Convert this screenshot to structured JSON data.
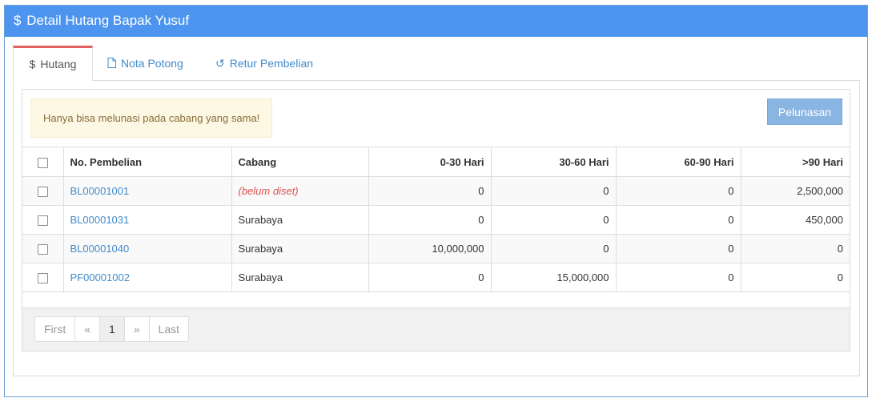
{
  "panel": {
    "icon": "dollar-icon",
    "title_symbol": "$",
    "title": "Detail Hutang Bapak Yusuf"
  },
  "tabs": [
    {
      "icon": "dollar-icon",
      "glyph": "$",
      "label": "Hutang",
      "active": true
    },
    {
      "icon": "document-icon",
      "label": "Nota Potong",
      "active": false
    },
    {
      "icon": "undo-icon",
      "glyph": "↺",
      "label": "Retur Pembelian",
      "active": false
    }
  ],
  "alert": {
    "text": "Hanya bisa melunasi pada cabang yang sama!"
  },
  "actions": {
    "pelunasan_label": "Pelunasan"
  },
  "table": {
    "headers": {
      "no_pembelian": "No. Pembelian",
      "cabang": "Cabang",
      "d0_30": "0-30 Hari",
      "d30_60": "30-60 Hari",
      "d60_90": "60-90 Hari",
      "d90plus": ">90 Hari"
    },
    "rows": [
      {
        "no": "BL00001001",
        "cabang": "(belum diset)",
        "d0_30": "0",
        "d30_60": "0",
        "d60_90": "0",
        "d90plus": "2,500,000"
      },
      {
        "no": "BL00001031",
        "cabang": "Surabaya",
        "d0_30": "0",
        "d30_60": "0",
        "d60_90": "0",
        "d90plus": "450,000"
      },
      {
        "no": "BL00001040",
        "cabang": "Surabaya",
        "d0_30": "10,000,000",
        "d30_60": "0",
        "d60_90": "0",
        "d90plus": "0"
      },
      {
        "no": "PF00001002",
        "cabang": "Surabaya",
        "d0_30": "0",
        "d30_60": "15,000,000",
        "d60_90": "0",
        "d90plus": "0"
      }
    ]
  },
  "pagination": {
    "first": "First",
    "prev": "«",
    "current": "1",
    "next": "»",
    "last": "Last"
  },
  "colors": {
    "header_bg": "#4d94ef",
    "link": "#428bca",
    "alert_bg": "#fcf8e3",
    "tab_active_accent": "#e06060"
  }
}
